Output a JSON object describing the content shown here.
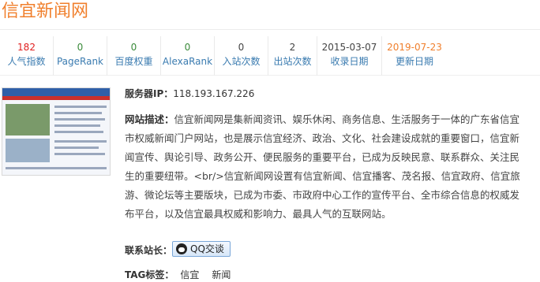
{
  "site": {
    "title": "信宜新闻网"
  },
  "stats": [
    {
      "value": "182",
      "label": "人气指数"
    },
    {
      "value": "0",
      "label": "PageRank"
    },
    {
      "value": "0",
      "label": "百度权重"
    },
    {
      "value": "0",
      "label": "AlexaRank"
    },
    {
      "value": "0",
      "label": "入站次数"
    },
    {
      "value": "2",
      "label": "出站次数"
    },
    {
      "value": "2015-03-07",
      "label": "收录日期"
    },
    {
      "value": "2019-07-23",
      "label": "更新日期"
    }
  ],
  "info": {
    "ip_label": "服务器IP：",
    "ip": "118.193.167.226",
    "desc_label": "网站描述：",
    "description": "信宜新闻网是集新闻资讯、娱乐休闲、商务信息、生活服务于一体的广东省信宜市权威新闻门户网站，也是展示信宜经济、政治、文化、社会建设成就的重要窗口，信宜新闻宣传、舆论引导、政务公开、便民服务的重要平台，已成为反映民意、联系群众、关注民生的重要纽带。<br/>信宜新闻网设置有信宜新闻、信宜播客、茂名报、信宜政府、信宜旅游、微论坛等主要版块，已成为市委、市政府中心工作的宣传平台、全市综合信息的权威发布平台，以及信宜最具权威和影响力、最具人气的互联网站。",
    "contact_label": "联系站长：",
    "qq_button": "QQ交谈",
    "tag_label": "TAG标签：",
    "tags": [
      "信宜",
      "新闻"
    ]
  },
  "colors": {
    "title": "#f07f2c",
    "red": "#e02020",
    "green": "#3a8a3a",
    "link": "#3a7bb0"
  },
  "icons": {
    "qq": "qq-penguin-icon"
  }
}
